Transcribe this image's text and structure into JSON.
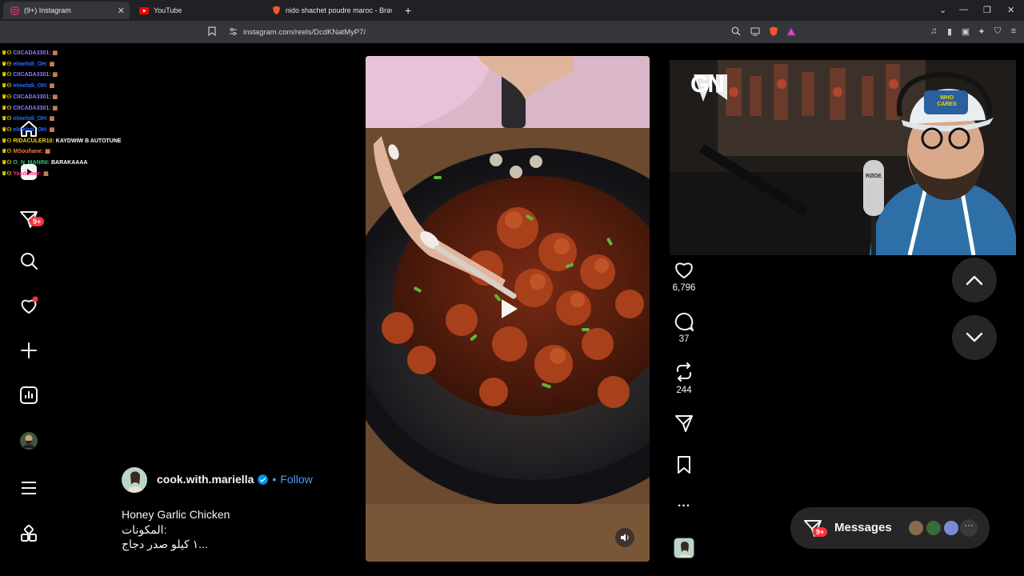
{
  "browser": {
    "tabs": [
      {
        "label": "(9+) Instagram",
        "active": true
      },
      {
        "label": "YouTube",
        "active": false
      },
      {
        "label": "nido shachet poudre maroc - Brave S",
        "active": false
      }
    ],
    "url": "instagram.com/reels/DcdKNatMyP7/"
  },
  "chat_overlay": [
    {
      "user": "CIICADA3301:",
      "msg": "",
      "color": "#8a7dff"
    },
    {
      "user": "elmehdi_OH:",
      "msg": "",
      "color": "#2e6bff"
    },
    {
      "user": "CIICADA3301:",
      "msg": "",
      "color": "#8a7dff"
    },
    {
      "user": "elmehdi_OH:",
      "msg": "",
      "color": "#2e6bff"
    },
    {
      "user": "CIICADA3301:",
      "msg": "",
      "color": "#8a7dff"
    },
    {
      "user": "CIICADA3301:",
      "msg": "",
      "color": "#8a7dff"
    },
    {
      "user": "elmehdi_OH:",
      "msg": "",
      "color": "#2e6bff"
    },
    {
      "user": "elmehdi_OH:",
      "msg": "",
      "color": "#2e6bff"
    },
    {
      "user": "RIDACULER10:",
      "msg": "KAYDWIW B AUTOTUNE",
      "color": "#f5d800"
    },
    {
      "user": "MSoufiane:",
      "msg": "",
      "color": "#ff7a2e"
    },
    {
      "user": "O_N_MANINI:",
      "msg": "BARAKAAAA",
      "color": "#30c07a"
    },
    {
      "user": "Yasdomar:",
      "msg": "",
      "color": "#ff2e8a"
    }
  ],
  "sidebar": {
    "notifications_badge": "9+"
  },
  "post": {
    "username": "cook.with.mariella",
    "follow_label": "Follow",
    "dot": "•",
    "caption_lines": [
      "Honey Garlic Chicken",
      "المكونات:",
      "١ كيلو صدر دجاج..."
    ]
  },
  "actions": {
    "likes": "6,796",
    "comments": "37",
    "reposts": "244",
    "more": "..."
  },
  "webcam": {
    "logo_text": "GN",
    "cap_text_top": "WHO",
    "cap_text_bottom": "CARES",
    "mic_label": "RØDE"
  },
  "messages": {
    "label": "Messages",
    "badge": "9+"
  },
  "colors": {
    "accent_blue": "#4a9eff",
    "badge_red": "#ff3040",
    "panel": "#262626"
  }
}
